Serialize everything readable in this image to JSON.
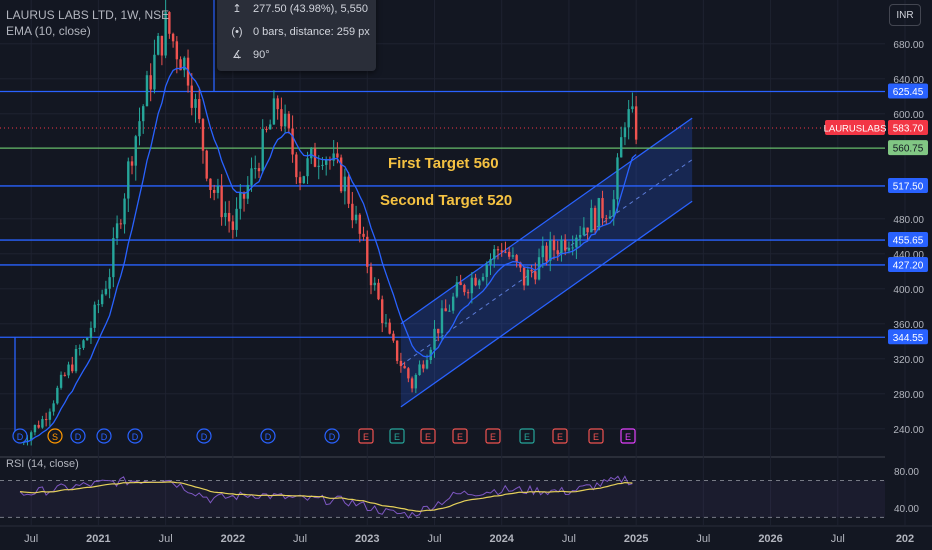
{
  "header": {
    "symbol_line": "LAURUS LABS LTD, 1W, NSE",
    "indicator_line": "EMA (10, close)",
    "currency_button": "INR"
  },
  "tooltip": {
    "rows": [
      {
        "icon": "range-icon",
        "glyph": "↥",
        "text": "277.50 (43.98%), 5,550"
      },
      {
        "icon": "bars-icon",
        "glyph": "(•)",
        "text": "0 bars, distance: 259 px"
      },
      {
        "icon": "angle-icon",
        "glyph": "∡",
        "text": "90°"
      }
    ]
  },
  "colors": {
    "background": "#131722",
    "up": "#26a69a",
    "down": "#ef5350",
    "ema": "#2962ff",
    "hline": "#2962ff",
    "target": "#66bb6a",
    "annotation": "#f5c242",
    "rsi": "#7e57c2",
    "rsi_ma": "#e6d15a",
    "price_label": "#f23645"
  },
  "chart_data": [
    {
      "type": "candlestick",
      "title": "LAURUS LABS LTD, 1W, NSE",
      "y_ticks": [
        "680.00",
        "640.00",
        "600.00",
        "480.00",
        "440.00",
        "400.00",
        "360.00",
        "320.00",
        "280.00",
        "240.00"
      ],
      "x_ticks": [
        "Jul",
        "2021",
        "Jul",
        "2022",
        "Jul",
        "2023",
        "Jul",
        "2024",
        "Jul",
        "2025",
        "Jul",
        "2026",
        "Jul",
        "202"
      ],
      "ylim": [
        210,
        730
      ],
      "x_range": [
        "2020-06",
        "2027-01"
      ],
      "series_ema": "EMA (10, close)",
      "last_price": {
        "label": "LAURUSLABS",
        "value": "583.70"
      },
      "horizontal_levels": [
        {
          "value": 625.45,
          "label": "625.45"
        },
        {
          "value": 560.75,
          "label": "560.75",
          "style": "target"
        },
        {
          "value": 517.5,
          "label": "517.50"
        },
        {
          "value": 455.65,
          "label": "455.65"
        },
        {
          "value": 427.2,
          "label": "427.20"
        },
        {
          "value": 344.55,
          "label": "344.55"
        }
      ],
      "annotations": [
        "First Target 560",
        "Second Target 520"
      ],
      "channel": {
        "upper": [
          [
            "2023-04",
            360
          ],
          [
            "2025-06",
            595
          ]
        ],
        "lower": [
          [
            "2023-04",
            265
          ],
          [
            "2025-06",
            500
          ]
        ]
      },
      "price_path": [
        [
          "2020-06",
          225
        ],
        [
          "2020-08",
          250
        ],
        [
          "2020-10",
          300
        ],
        [
          "2020-12",
          345
        ],
        [
          "2021-02",
          420
        ],
        [
          "2021-04",
          560
        ],
        [
          "2021-06",
          660
        ],
        [
          "2021-07",
          700
        ],
        [
          "2021-09",
          650
        ],
        [
          "2021-11",
          520
        ],
        [
          "2022-01",
          470
        ],
        [
          "2022-03",
          540
        ],
        [
          "2022-05",
          610
        ],
        [
          "2022-07",
          530
        ],
        [
          "2022-09",
          560
        ],
        [
          "2022-11",
          520
        ],
        [
          "2023-01",
          430
        ],
        [
          "2023-03",
          340
        ],
        [
          "2023-05",
          290
        ],
        [
          "2023-07",
          350
        ],
        [
          "2023-09",
          395
        ],
        [
          "2023-11",
          420
        ],
        [
          "2024-01",
          450
        ],
        [
          "2024-03",
          410
        ],
        [
          "2024-05",
          440
        ],
        [
          "2024-07",
          460
        ],
        [
          "2024-09",
          480
        ],
        [
          "2024-11",
          500
        ],
        [
          "2024-12",
          600
        ],
        [
          "2025-01",
          583.7
        ]
      ],
      "event_markers": [
        "D",
        "S",
        "D",
        "D",
        "D",
        "D",
        "D",
        "D",
        "E",
        "E",
        "E",
        "E",
        "E",
        "E",
        "E",
        "E",
        "E",
        "E"
      ]
    },
    {
      "type": "line",
      "title": "RSI (14, close)",
      "y_ticks": [
        "80.00",
        "40.00"
      ],
      "ylim": [
        25,
        90
      ],
      "rsi_path": [
        [
          "2020-06",
          55
        ],
        [
          "2020-10",
          62
        ],
        [
          "2021-02",
          68
        ],
        [
          "2021-07",
          72
        ],
        [
          "2021-11",
          50
        ],
        [
          "2022-03",
          55
        ],
        [
          "2022-07",
          50
        ],
        [
          "2022-11",
          48
        ],
        [
          "2023-03",
          35
        ],
        [
          "2023-05",
          33
        ],
        [
          "2023-09",
          55
        ],
        [
          "2024-01",
          60
        ],
        [
          "2024-07",
          58
        ],
        [
          "2024-12",
          72
        ],
        [
          "2025-01",
          66
        ]
      ]
    }
  ]
}
